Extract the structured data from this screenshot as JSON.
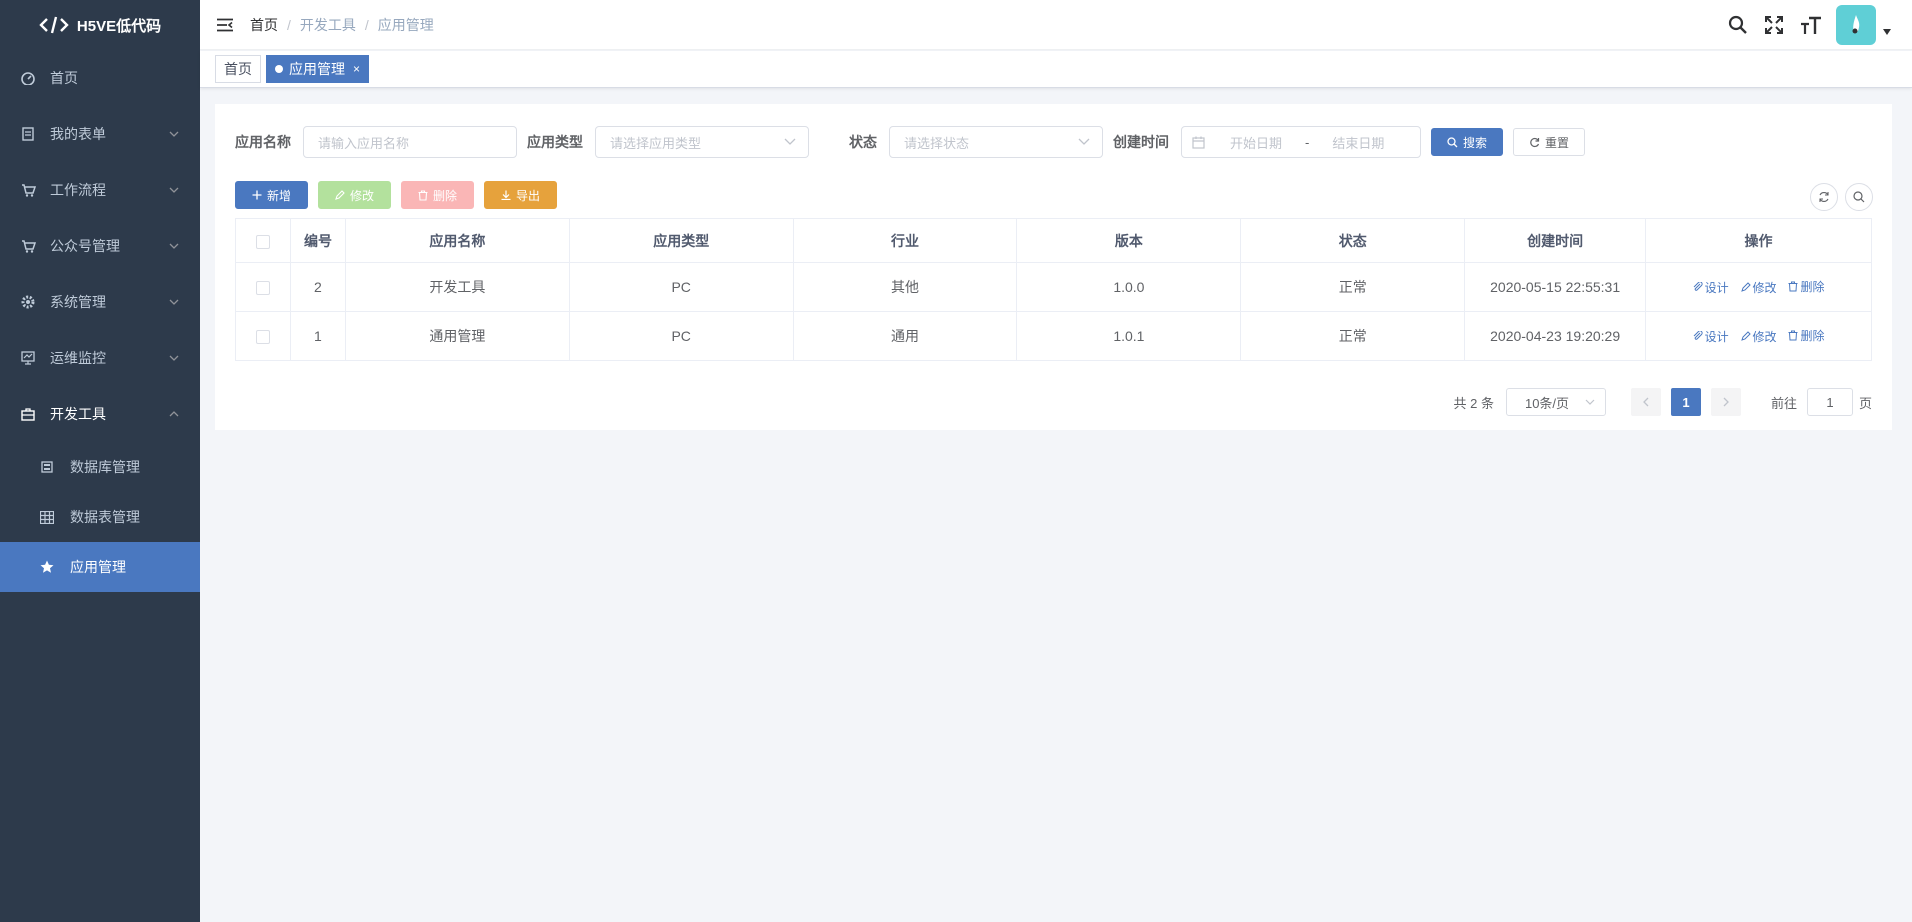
{
  "app": {
    "logo_text": "H5VE低代码"
  },
  "sidebar": {
    "items": [
      {
        "label": "首页",
        "icon": "dashboard-icon",
        "expandable": false
      },
      {
        "label": "我的表单",
        "icon": "form-icon",
        "expandable": true
      },
      {
        "label": "工作流程",
        "icon": "cart-icon",
        "expandable": true
      },
      {
        "label": "公众号管理",
        "icon": "cart-icon",
        "expandable": true
      },
      {
        "label": "系统管理",
        "icon": "gear-icon",
        "expandable": true
      },
      {
        "label": "运维监控",
        "icon": "monitor-icon",
        "expandable": true
      },
      {
        "label": "开发工具",
        "icon": "toolbox-icon",
        "expandable": true,
        "open": true
      }
    ],
    "sub_items": [
      {
        "label": "数据库管理",
        "icon": "database-icon"
      },
      {
        "label": "数据表管理",
        "icon": "table-icon"
      },
      {
        "label": "应用管理",
        "icon": "star-icon",
        "active": true
      }
    ]
  },
  "header": {
    "breadcrumb": [
      "首页",
      "开发工具",
      "应用管理"
    ],
    "separator": "/"
  },
  "tags": [
    {
      "label": "首页",
      "active": false
    },
    {
      "label": "应用管理",
      "active": true,
      "close": "×"
    }
  ],
  "search": {
    "name_label": "应用名称",
    "name_placeholder": "请输入应用名称",
    "type_label": "应用类型",
    "type_placeholder": "请选择应用类型",
    "status_label": "状态",
    "status_placeholder": "请选择状态",
    "created_label": "创建时间",
    "start_placeholder": "开始日期",
    "range_sep": "-",
    "end_placeholder": "结束日期",
    "search_btn": "搜索",
    "reset_btn": "重置"
  },
  "toolbar": {
    "add": "新增",
    "edit": "修改",
    "delete": "删除",
    "export": "导出"
  },
  "table": {
    "columns": [
      "编号",
      "应用名称",
      "应用类型",
      "行业",
      "版本",
      "状态",
      "创建时间",
      "操作"
    ],
    "rows": [
      {
        "id": "2",
        "name": "开发工具",
        "type": "PC",
        "industry": "其他",
        "version": "1.0.0",
        "status": "正常",
        "created": "2020-05-15 22:55:31"
      },
      {
        "id": "1",
        "name": "通用管理",
        "type": "PC",
        "industry": "通用",
        "version": "1.0.1",
        "status": "正常",
        "created": "2020-04-23 19:20:29"
      }
    ],
    "actions": {
      "design": "设计",
      "edit": "修改",
      "delete": "删除"
    }
  },
  "pagination": {
    "total_text": "共 2 条",
    "page_size": "10条/页",
    "current_page": "1",
    "goto_prefix": "前往",
    "goto_value": "1",
    "goto_suffix": "页"
  },
  "colors": {
    "sidebar_bg": "#2d3a4b",
    "primary": "#4a78c0",
    "success_light": "#b3e19d",
    "danger_light": "#fab6b6",
    "warning": "#e6a23c",
    "avatar": "#5fcfd6"
  }
}
